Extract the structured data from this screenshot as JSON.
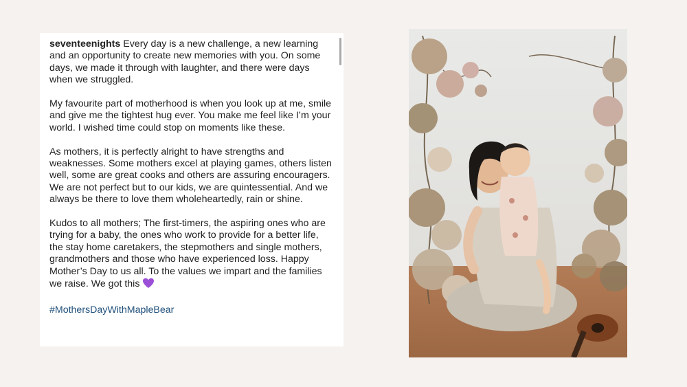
{
  "post": {
    "username": "seventeenights",
    "paragraph1": "Every day is a new challenge, a new learning and an opportunity to create new memories with you. On some days, we made it through with laughter, and there were days when we struggled.",
    "paragraph2": "My favourite part of motherhood is when you look up at me, smile and give me the tightest hug ever. You make me feel like I’m your world. I wished time could stop on moments like these.",
    "paragraph3": "As mothers, it is perfectly alright to have strengths and weaknesses. Some mothers excel at playing games, others listen well, some are great cooks and others are assuring encouragers. We are not perfect but to our kids, we are quintessential. And we always be there to love them wholeheartedly, rain or shine.",
    "paragraph4": "Kudos to all mothers; The first-timers, the aspiring ones who are trying for a baby, the ones who work to provide for a better life, the stay home caretakers, the stepmothers and single mothers, grandmothers and those who have experienced loss. Happy Mother’s Day to us all. To the values we impart and the families we raise. We got this",
    "hashtag": "#MothersDayWithMapleBear",
    "emoji_icon": "purple-heart-icon"
  },
  "photo": {
    "subject": "mother-and-child-portrait"
  },
  "colors": {
    "background": "#f6f2ef",
    "card": "#ffffff",
    "text": "#1f1f1f",
    "hashtag": "#1f4f7a",
    "heart": "#9b4fd6"
  }
}
